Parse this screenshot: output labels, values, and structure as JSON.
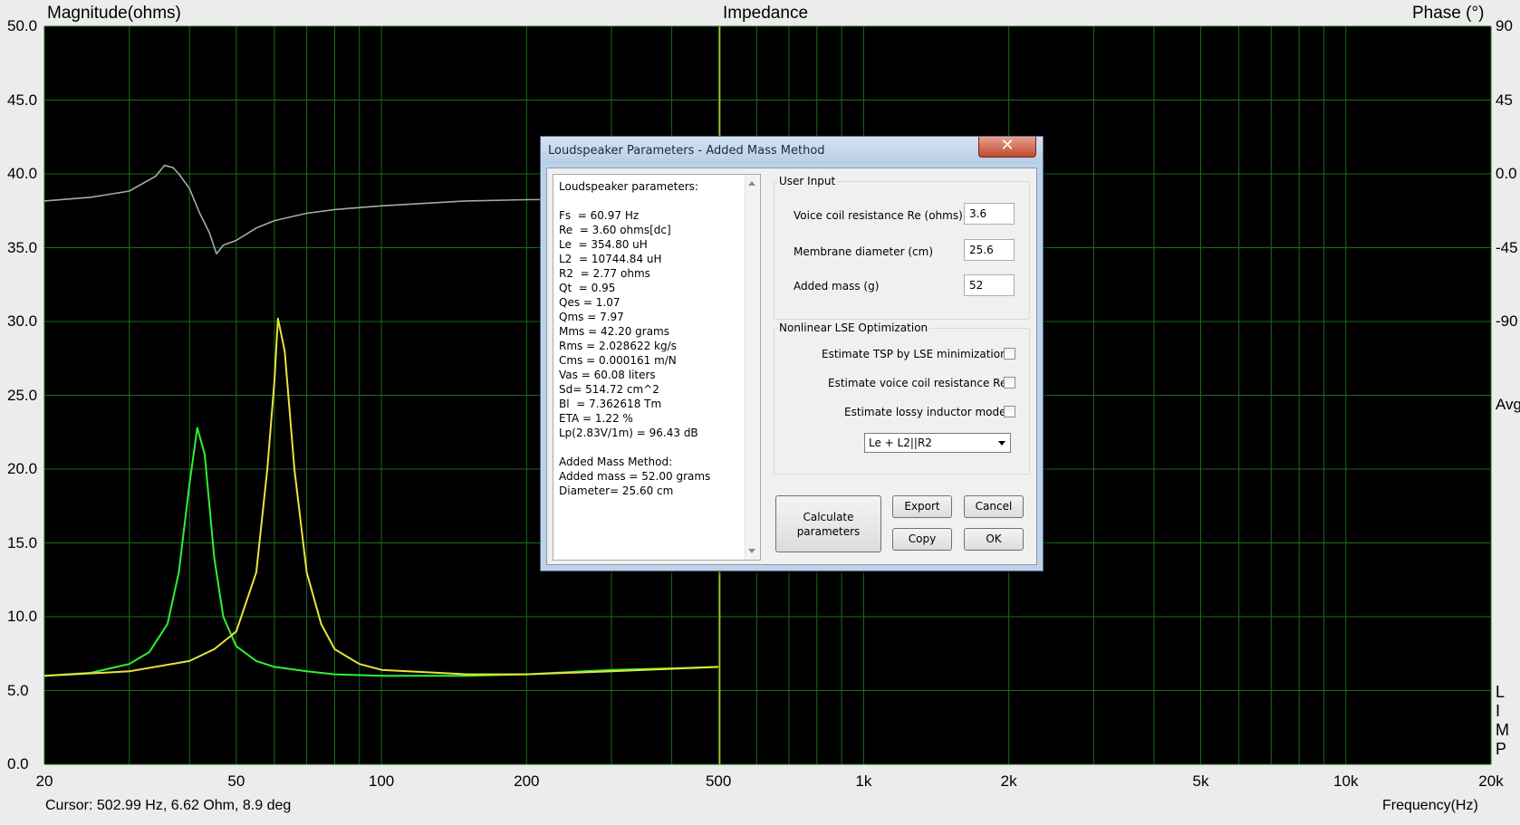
{
  "plot": {
    "title": "Impedance",
    "left_axis_label": "Magnitude(ohms)",
    "right_axis_label": "Phase (°)",
    "y_ticks": [
      "50.0",
      "45.0",
      "40.0",
      "35.0",
      "30.0",
      "25.0",
      "20.0",
      "15.0",
      "10.0",
      "5.0",
      "0.0"
    ],
    "right_ticks": [
      "90",
      "45",
      "0.0",
      "-45",
      "-90"
    ],
    "right_avg_label": "Avg",
    "right_limp_label": "LIMP",
    "x_ticks": [
      "20",
      "50",
      "100",
      "200",
      "500",
      "1k",
      "2k",
      "5k",
      "10k",
      "20k"
    ],
    "cursor_text": "Cursor: 502.99 Hz, 6.62 Ohm, 8.9 deg",
    "x_axis_label": "Frequency(Hz)",
    "colors": {
      "background": "#000000",
      "grid": "#1d6b1d",
      "green_curve": "#2ef22e",
      "yellow_curve": "#e8e43c",
      "phase_curve": "#a8a8a8",
      "cursor": "#c8c832"
    }
  },
  "chart_data": {
    "type": "line",
    "x_scale": "log",
    "xlim": [
      20,
      20000
    ],
    "ylim": [
      0,
      50
    ],
    "xlabel": "Frequency(Hz)",
    "ylabel": "Magnitude(ohms)",
    "y2label": "Phase (°)",
    "y2lim": [
      -90,
      90
    ],
    "cursor_x": 503,
    "series": [
      {
        "axis": "left",
        "color": "#2ef22e",
        "points": [
          [
            20,
            6.0
          ],
          [
            25,
            6.2
          ],
          [
            30,
            6.8
          ],
          [
            33,
            7.6
          ],
          [
            36,
            9.5
          ],
          [
            38,
            13
          ],
          [
            40,
            19
          ],
          [
            41.5,
            22.8
          ],
          [
            43,
            21
          ],
          [
            45,
            14
          ],
          [
            47,
            10
          ],
          [
            50,
            8
          ],
          [
            55,
            7
          ],
          [
            60,
            6.6
          ],
          [
            70,
            6.3
          ],
          [
            80,
            6.1
          ],
          [
            100,
            6.0
          ],
          [
            150,
            6.0
          ],
          [
            200,
            6.1
          ],
          [
            300,
            6.4
          ],
          [
            400,
            6.5
          ],
          [
            500,
            6.6
          ]
        ]
      },
      {
        "axis": "left",
        "color": "#e8e43c",
        "points": [
          [
            20,
            6.0
          ],
          [
            30,
            6.3
          ],
          [
            40,
            7.0
          ],
          [
            45,
            7.8
          ],
          [
            50,
            9
          ],
          [
            55,
            13
          ],
          [
            58,
            20
          ],
          [
            60,
            26
          ],
          [
            61,
            30.2
          ],
          [
            63,
            28
          ],
          [
            66,
            20
          ],
          [
            70,
            13
          ],
          [
            75,
            9.5
          ],
          [
            80,
            7.8
          ],
          [
            90,
            6.8
          ],
          [
            100,
            6.4
          ],
          [
            150,
            6.1
          ],
          [
            200,
            6.1
          ],
          [
            300,
            6.3
          ],
          [
            500,
            6.6
          ]
        ]
      },
      {
        "axis": "right",
        "color": "#a8a8a8",
        "points": [
          [
            20,
            8
          ],
          [
            25,
            11
          ],
          [
            30,
            16
          ],
          [
            34,
            28
          ],
          [
            35.5,
            37
          ],
          [
            37,
            35
          ],
          [
            38,
            30
          ],
          [
            40,
            18
          ],
          [
            42,
            -2
          ],
          [
            44,
            -18
          ],
          [
            45.5,
            -35
          ],
          [
            47,
            -28
          ],
          [
            50,
            -24
          ],
          [
            55,
            -14
          ],
          [
            60,
            -8
          ],
          [
            70,
            -2
          ],
          [
            80,
            1
          ],
          [
            100,
            4
          ],
          [
            150,
            8
          ],
          [
            200,
            9
          ],
          [
            300,
            9.5
          ],
          [
            500,
            9
          ]
        ]
      }
    ]
  },
  "dialog": {
    "title": "Loudspeaker Parameters - Added Mass Method",
    "close_label": "✕",
    "params_lines": "Loudspeaker parameters:\n\nFs  = 60.97 Hz\nRe  = 3.60 ohms[dc]\nLe  = 354.80 uH\nL2  = 10744.84 uH\nR2  = 2.77 ohms\nQt  = 0.95\nQes = 1.07\nQms = 7.97\nMms = 42.20 grams\nRms = 2.028622 kg/s\nCms = 0.000161 m/N\nVas = 60.08 liters\nSd= 514.72 cm^2\nBl  = 7.362618 Tm\nETA = 1.22 %\nLp(2.83V/1m) = 96.43 dB\n\nAdded Mass Method:\nAdded mass = 52.00 grams\nDiameter= 25.60 cm",
    "user_input": {
      "group_label": "User Input",
      "re_label": "Voice coil resistance Re (ohms)",
      "re_value": "3.6",
      "diam_label": "Membrane diameter (cm)",
      "diam_value": "25.6",
      "mass_label": "Added mass (g)",
      "mass_value": "52"
    },
    "lse": {
      "group_label": "Nonlinear LSE Optimization",
      "opt1": "Estimate TSP by LSE minimization",
      "opt2": "Estimate voice coil resistance Re",
      "opt3": "Estimate lossy inductor model",
      "model_value": "Le + L2||R2"
    },
    "buttons": {
      "calculate": "Calculate\nparameters",
      "export": "Export",
      "cancel": "Cancel",
      "copy": "Copy",
      "ok": "OK"
    }
  }
}
